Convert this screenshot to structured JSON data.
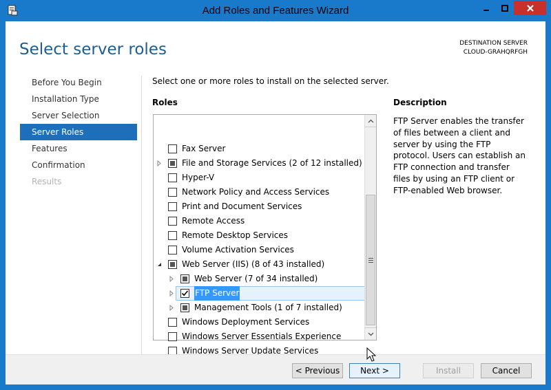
{
  "window": {
    "title": "Add Roles and Features Wizard"
  },
  "header": {
    "title": "Select server roles",
    "destination_label": "DESTINATION SERVER",
    "destination_value": "CLOUD-GRAHQRFGH"
  },
  "nav": {
    "items": [
      {
        "label": "Before You Begin",
        "state": "normal"
      },
      {
        "label": "Installation Type",
        "state": "normal"
      },
      {
        "label": "Server Selection",
        "state": "normal"
      },
      {
        "label": "Server Roles",
        "state": "active"
      },
      {
        "label": "Features",
        "state": "normal"
      },
      {
        "label": "Confirmation",
        "state": "normal"
      },
      {
        "label": "Results",
        "state": "disabled"
      }
    ]
  },
  "main": {
    "intro": "Select one or more roles to install on the selected server.",
    "roles_label": "Roles",
    "roles": [
      {
        "label": "Fax Server",
        "state": "unchecked",
        "expander": "none",
        "indent": 0
      },
      {
        "label": "File and Storage Services (2 of 12 installed)",
        "state": "partial",
        "expander": "collapsed",
        "indent": 0
      },
      {
        "label": "Hyper-V",
        "state": "unchecked",
        "expander": "none",
        "indent": 0
      },
      {
        "label": "Network Policy and Access Services",
        "state": "unchecked",
        "expander": "none",
        "indent": 0
      },
      {
        "label": "Print and Document Services",
        "state": "unchecked",
        "expander": "none",
        "indent": 0
      },
      {
        "label": "Remote Access",
        "state": "unchecked",
        "expander": "none",
        "indent": 0
      },
      {
        "label": "Remote Desktop Services",
        "state": "unchecked",
        "expander": "none",
        "indent": 0
      },
      {
        "label": "Volume Activation Services",
        "state": "unchecked",
        "expander": "none",
        "indent": 0
      },
      {
        "label": "Web Server (IIS) (8 of 43 installed)",
        "state": "partial",
        "expander": "expanded",
        "indent": 0
      },
      {
        "label": "Web Server (7 of 34 installed)",
        "state": "partial",
        "expander": "collapsed",
        "indent": 1
      },
      {
        "label": "FTP Server",
        "state": "checked",
        "expander": "collapsed",
        "indent": 1,
        "selected": true
      },
      {
        "label": "Management Tools (1 of 7 installed)",
        "state": "partial",
        "expander": "collapsed",
        "indent": 1
      },
      {
        "label": "Windows Deployment Services",
        "state": "unchecked",
        "expander": "none",
        "indent": 0
      },
      {
        "label": "Windows Server Essentials Experience",
        "state": "unchecked",
        "expander": "none",
        "indent": 0
      },
      {
        "label": "Windows Server Update Services",
        "state": "unchecked",
        "expander": "none",
        "indent": 0
      }
    ]
  },
  "description": {
    "label": "Description",
    "text": "FTP Server enables the transfer of files between a client and server by using the FTP protocol. Users can establish an FTP connection and transfer files by using an FTP client or FTP-enabled Web browser."
  },
  "footer": {
    "previous_label": "< Previous",
    "next_label": "Next >",
    "install_label": "Install",
    "cancel_label": "Cancel"
  }
}
